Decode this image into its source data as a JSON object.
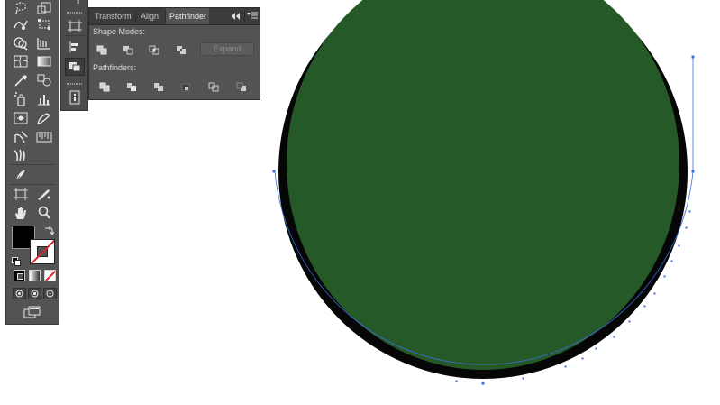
{
  "panel": {
    "tabs": [
      "Transform",
      "Align",
      "Pathfinder"
    ],
    "active_tab": "Pathfinder",
    "shape_modes_label": "Shape Modes:",
    "pathfinders_label": "Pathfinders:",
    "expand_label": "Expand",
    "collapse_icon": "double-chevron-left-icon",
    "menu_icon": "panel-menu-icon"
  },
  "shape_mode_buttons": [
    "unite",
    "minus-front",
    "intersect",
    "exclude"
  ],
  "pathfinder_buttons": [
    "divide",
    "trim",
    "merge",
    "crop",
    "outline",
    "minus-back"
  ],
  "tools": [
    "lasso-tool",
    "scale-tool",
    "warp-tool",
    "free-transform-tool",
    "shape-builder-tool",
    "perspective-grid-tool",
    "mesh-tool",
    "gradient-tool",
    "eyedropper-tool",
    "blend-tool",
    "symbol-sprayer-tool",
    "column-graph-tool",
    "artboard-tool",
    "slice-tool",
    "eraser-tool",
    "scissors-tool",
    "puppet-tool",
    "pen-tool",
    "hand-tool",
    "zoom-tool"
  ],
  "dock_icons": [
    "artboards-icon",
    "align-icon",
    "pathfinder-icon",
    "info-icon"
  ],
  "colors": {
    "panel_bg": "#535353",
    "tab_bar": "#3c3c3c",
    "circle_fill": "#265928",
    "circle_stroke": "#060606",
    "selection": "#3b6fe0",
    "fill_swatch": "#000000",
    "stroke_none": "#d92626"
  }
}
